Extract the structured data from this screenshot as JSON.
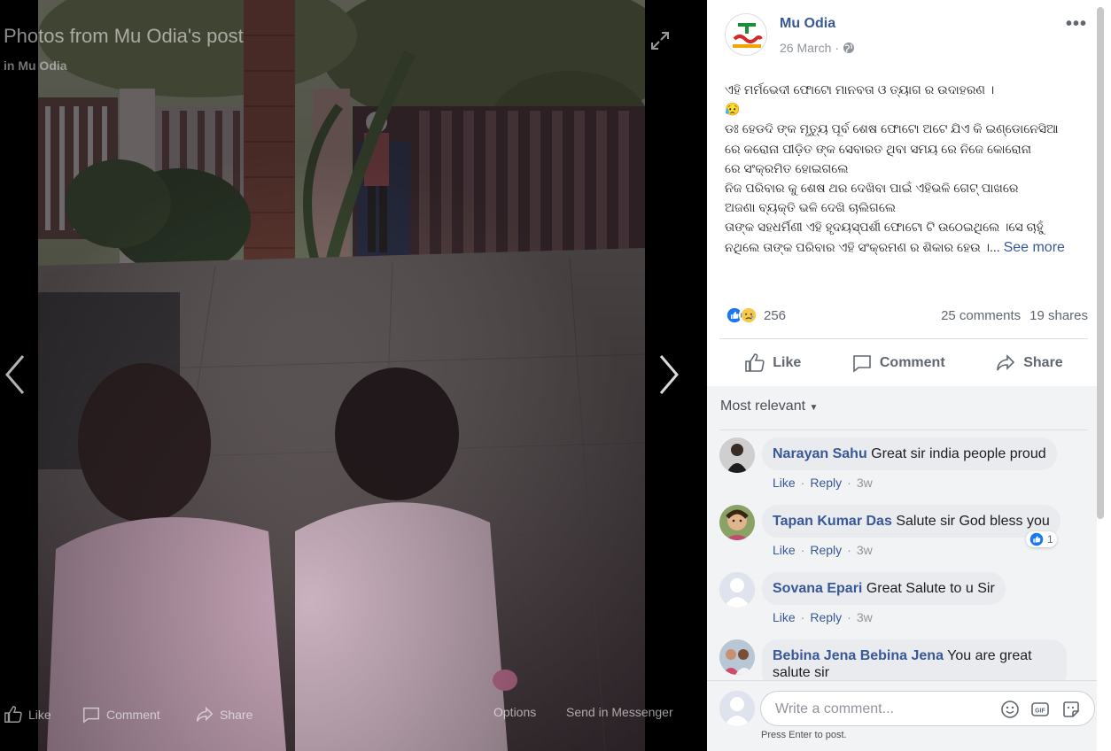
{
  "viewer": {
    "title": "Photos from Mu Odia's post",
    "subtitle": "in Mu Odia",
    "bottom_bar": {
      "like": "Like",
      "comment": "Comment",
      "share": "Share",
      "options": "Options",
      "send": "Send in Messenger"
    }
  },
  "post": {
    "page_name": "Mu Odia",
    "date": "26 March",
    "separator": "·",
    "lines": [
      "ଏହି ମର୍ମଭେଦୀ ଫୋଟୋ ମାନବତା ଓ ତ୍ୟାଗ ର ଉଦାହରଣ ।",
      "😥",
      "ଡଃ ହେଡଦି ଙ୍କ ମୃତ୍ୟୁ ପୂର୍ବ ଶେଷ ଫୋଟୋ ଅଟେ ଯିଏ କି ଇଣ୍ଡୋନେସିଆ",
      "ରେ କରୋନା ପୀଡ଼ିତ ଙ୍କ ସେବାରତ ଥିବା ସମୟ ରେ ନିଜେ କୋରୋନା",
      "ରେ ସଂକ୍ରମିତ ହୋଇଗଲେ",
      "ନିଜ ପରିବାର କୁ ଶେଷ ଥର ଦେଖିବା ପାଇଁ ଏହିଭଳି ଗେଟ୍ ପାଖରେ",
      "ଅଜଣା ବ୍ୟକ୍ତି ଭଳି ଦେଖି ଚାଲିଗଲେ",
      "ତାଙ୍କ ସହଧର୍ମିଣୀ ଏହି ହୃଦୟସ୍ପର୍ଶୀ ଫୋଟୋ ଟି ଉଠେଇଥିଲେ ।ସେ ଚାହୁଁ",
      "ନଥିଲେ ତାଙ୍କ ପରିବାର ଏହି ସଂକ୍ରମଣ ର ଶିକାର ହେଉ ।..."
    ],
    "see_more": "See more",
    "reaction_count": "256",
    "comments_count": "25 comments",
    "shares_count": "19 shares",
    "actions": {
      "like": "Like",
      "comment": "Comment",
      "share": "Share"
    },
    "sort_label": "Most relevant"
  },
  "comments": [
    {
      "author": "Narayan Sahu",
      "text": "Great sir india people proud",
      "like": "Like",
      "reply": "Reply",
      "time": "3w"
    },
    {
      "author": "Tapan Kumar Das",
      "text": "Salute sir God bless you",
      "like": "Like",
      "reply": "Reply",
      "time": "3w",
      "reactions": "1"
    },
    {
      "author": "Sovana Epari",
      "text": "Great Salute to u Sir",
      "like": "Like",
      "reply": "Reply",
      "time": "3w"
    },
    {
      "author": "Bebina Jena Bebina Jena",
      "text": "You are great",
      "text2": "salute sir"
    }
  ],
  "composer": {
    "placeholder": "Write a comment...",
    "hint": "Press Enter to post.",
    "gif": "GIF"
  },
  "colors": {
    "link": "#385898",
    "like_blue": "#1877f2",
    "sad_yellow": "#f7c94b"
  }
}
